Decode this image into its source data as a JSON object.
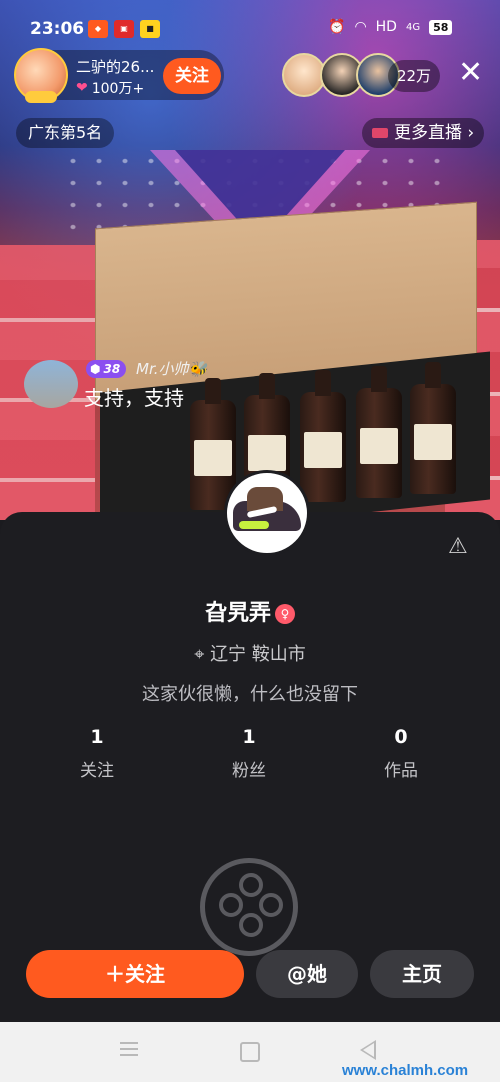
{
  "status_bar": {
    "time": "23:06",
    "network": "HD",
    "signal": "4G",
    "battery": "58"
  },
  "stream": {
    "host_name": "二驴的26...",
    "host_likes": "100万+",
    "follow_label": "关注",
    "viewer_count": "22万",
    "rank": "广东第5名",
    "more_live": "更多直播 ›"
  },
  "chat": {
    "level": "38",
    "user": "Mr.小帅🐝",
    "message": "支持，支持"
  },
  "profile": {
    "name": "旮旯弄",
    "location": "辽宁 鞍山市",
    "bio": "这家伙很懒，什么也没留下",
    "stats": [
      {
        "value": "1",
        "label": "关注"
      },
      {
        "value": "1",
        "label": "粉丝"
      },
      {
        "value": "0",
        "label": "作品"
      }
    ]
  },
  "actions": {
    "follow": "＋关注",
    "mention": "@她",
    "home": "主页"
  },
  "watermark": "www.chalmh.com",
  "colors": {
    "accent": "#ff5a1f",
    "card_bg": "#1d1d21",
    "level_badge": "#8b4ff0"
  }
}
